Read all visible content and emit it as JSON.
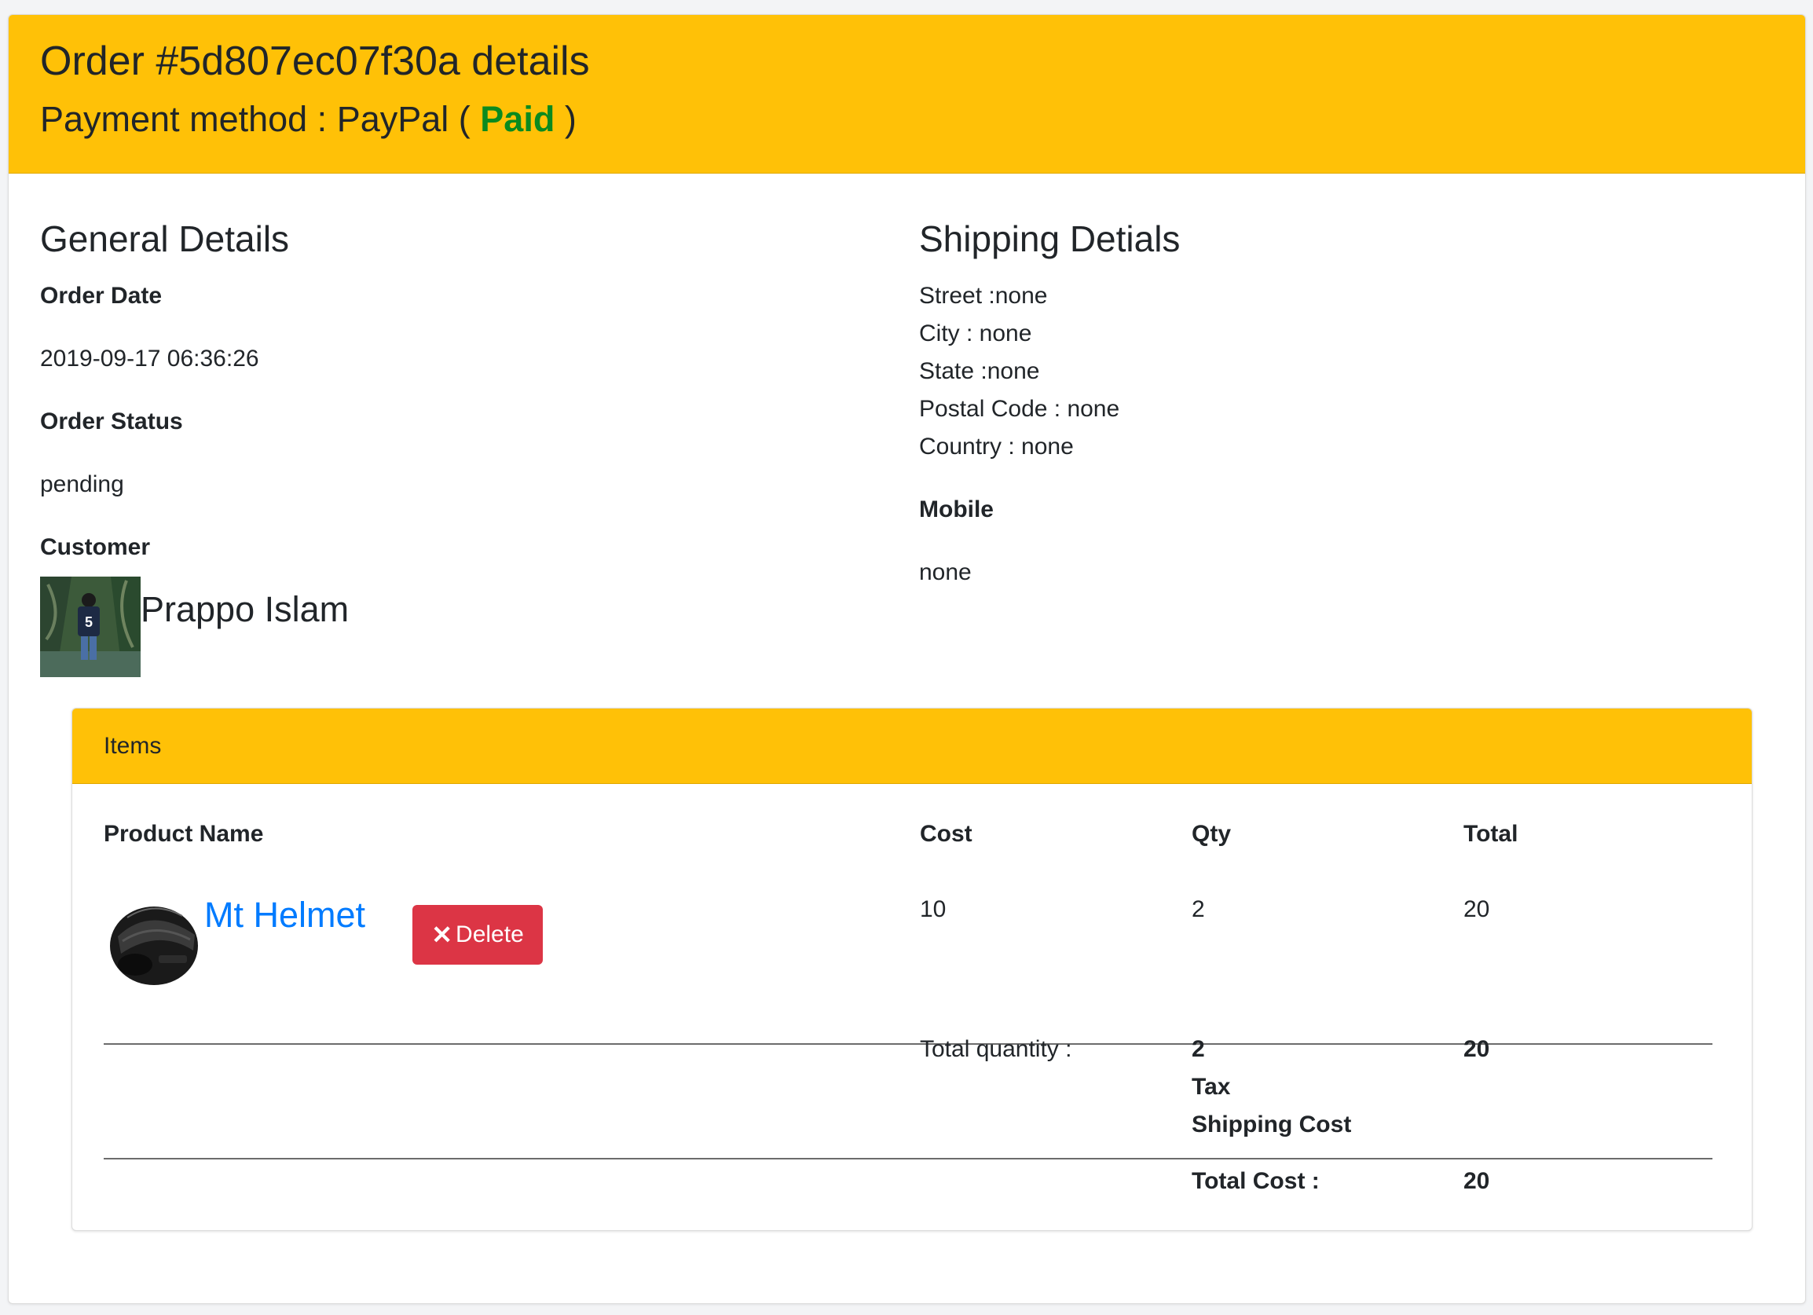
{
  "header": {
    "title": "Order #5d807ec07f30a details",
    "payment_prefix": "Payment method : PayPal (",
    "payment_status": "Paid",
    "payment_suffix": ")",
    "accent_color": "#ffc107",
    "status_color": "#0a8a1f"
  },
  "general": {
    "heading": "General Details",
    "order_date_label": "Order Date",
    "order_date": "2019-09-17 06:36:26",
    "order_status_label": "Order Status",
    "order_status": "pending",
    "customer_label": "Customer",
    "customer_name": "Prappo Islam"
  },
  "shipping": {
    "heading": "Shipping Detials",
    "street": "Street :none",
    "city": "City : none",
    "state": "State :none",
    "postal_code": "Postal Code : none",
    "country": "Country : none",
    "mobile_label": "Mobile",
    "mobile": "none"
  },
  "items": {
    "heading": "Items",
    "columns": [
      "Product Name",
      "Cost",
      "Qty",
      "Total"
    ],
    "rows": [
      {
        "product": "Mt Helmet",
        "delete_label": "Delete",
        "cost": "10",
        "qty": "2",
        "total": "20"
      }
    ],
    "summary": {
      "total_quantity_label": "Total quantity :",
      "total_quantity": "2",
      "total_quantity_total": "20",
      "tax_label": "Tax",
      "shipping_cost_label": "Shipping Cost",
      "total_cost_label": "Total Cost :",
      "total_cost": "20"
    },
    "delete_color": "#dc3545",
    "link_color": "#007bff"
  }
}
